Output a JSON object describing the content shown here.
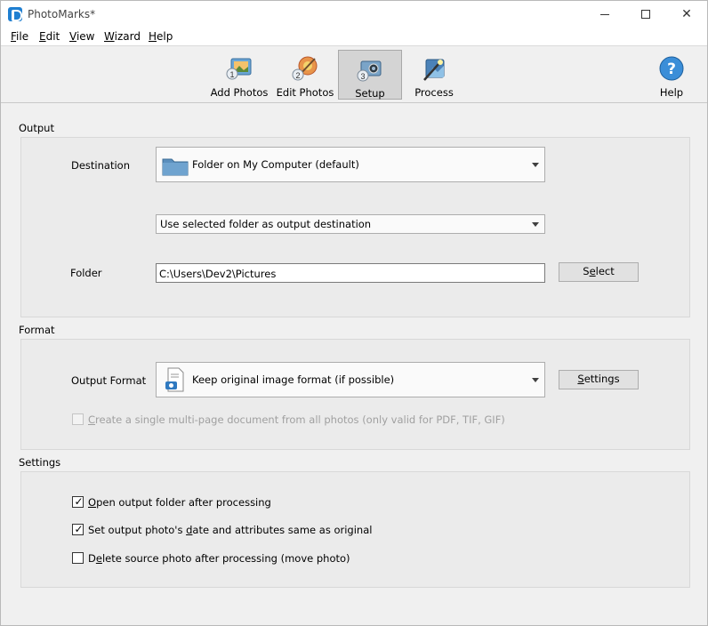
{
  "window": {
    "title": "PhotoMarks*"
  },
  "menu": [
    {
      "pre": "",
      "key": "F",
      "post": "ile"
    },
    {
      "pre": "",
      "key": "E",
      "post": "dit"
    },
    {
      "pre": "",
      "key": "V",
      "post": "iew"
    },
    {
      "pre": "",
      "key": "W",
      "post": "izard"
    },
    {
      "pre": "",
      "key": "H",
      "post": "elp"
    }
  ],
  "toolbar": {
    "add_photos": "Add Photos",
    "edit_photos": "Edit Photos",
    "setup": "Setup",
    "process": "Process",
    "help": "Help",
    "step1": "1",
    "step2": "2",
    "step3": "3"
  },
  "output": {
    "section": "Output",
    "destination_label": "Destination",
    "destination_value": "Folder on My Computer (default)",
    "folder_mode_value": "Use selected folder as output destination",
    "folder_label": "Folder",
    "folder_path": "C:\\Users\\Dev2\\Pictures",
    "select_pre": "S",
    "select_key": "e",
    "select_post": "lect"
  },
  "format": {
    "section": "Format",
    "output_format_label": "Output Format",
    "output_format_value": "Keep original image format (if possible)",
    "settings_key": "S",
    "settings_post": "ettings",
    "multipage_pre": "",
    "multipage_key": "C",
    "multipage_post": "reate a single multi-page document from all photos (only valid for PDF, TIF, GIF)"
  },
  "settings": {
    "section": "Settings",
    "open_folder_key": "O",
    "open_folder_post": "pen output folder after processing",
    "open_folder_checked": true,
    "set_date_pre": "Set output photo's ",
    "set_date_key": "d",
    "set_date_post": "ate and attributes same as original",
    "set_date_checked": true,
    "delete_source_pre": "D",
    "delete_source_key": "e",
    "delete_source_post": "lete source photo after processing (move photo)",
    "delete_source_checked": false
  }
}
